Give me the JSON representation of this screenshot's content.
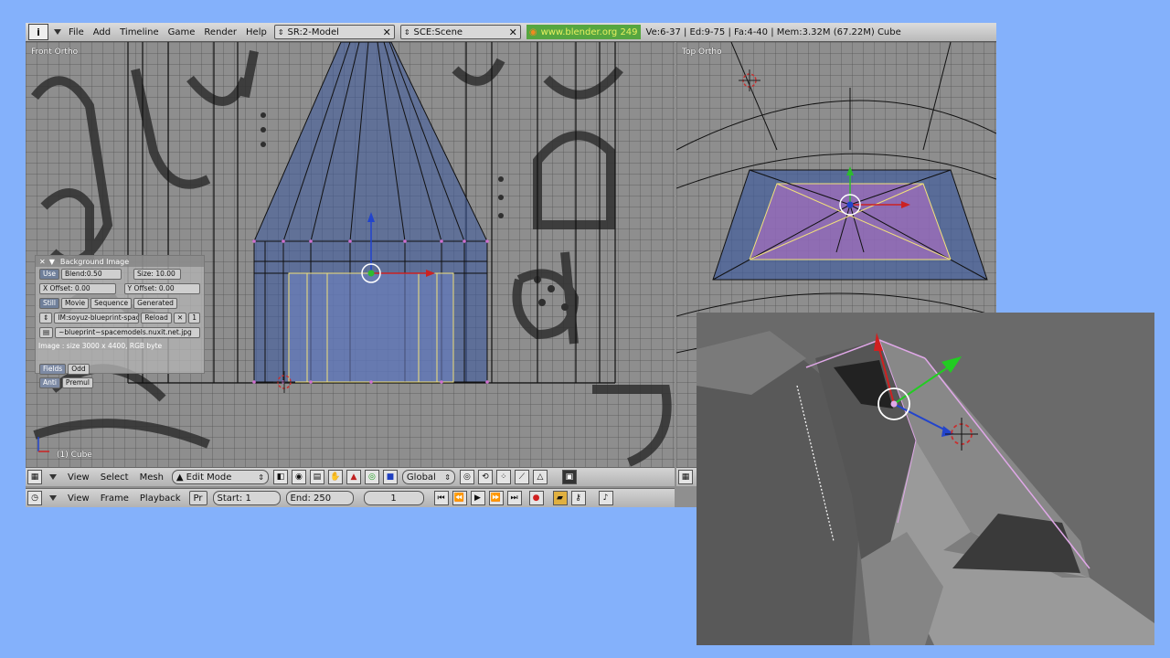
{
  "topbar": {
    "info": "i",
    "menus": [
      "File",
      "Add",
      "Timeline",
      "Game",
      "Render",
      "Help"
    ],
    "screen_select": "SR:2-Model",
    "scene_select": "SCE:Scene",
    "site_link": "www.blender.org 249",
    "stats": "Ve:6-37 | Ed:9-75 | Fa:4-40 | Mem:3.32M (67.22M) Cube"
  },
  "front_view": {
    "label": "Front Ortho",
    "object_label": "(1) Cube"
  },
  "top_view": {
    "label": "Top Ortho"
  },
  "bg_panel": {
    "title": "Background Image",
    "use": "Use",
    "blend": "Blend:0.50",
    "size": "Size: 10.00",
    "x_offset": "X Offset: 0.00",
    "y_offset": "Y Offset: 0.00",
    "tabs": [
      "Still",
      "Movie",
      "Sequence",
      "Generated"
    ],
    "image_name": "IM:soyuz-blueprint-space",
    "reload": "Reload",
    "users": "1",
    "file_path": "~blueprint~spacemodels.nuxit.net.jpg",
    "image_info": "Image : size 3000 x 4400, RGB byte",
    "fields": "Fields",
    "odd": "Odd",
    "anti": "Anti",
    "premul": "Premul"
  },
  "view3d_header": {
    "menus": [
      "View",
      "Select",
      "Mesh"
    ],
    "mode": "Edit Mode",
    "orientation": "Global"
  },
  "timeline_header": {
    "menus": [
      "View",
      "Frame",
      "Playback"
    ],
    "pr": "Pr",
    "start": "Start: 1",
    "end": "End: 250",
    "current_frame": "1"
  },
  "colors": {
    "background": "#84b1fb",
    "mesh_fill": "#3d5a9e",
    "face_select": "#b46ec4",
    "edge_selected": "#f3e27a"
  }
}
